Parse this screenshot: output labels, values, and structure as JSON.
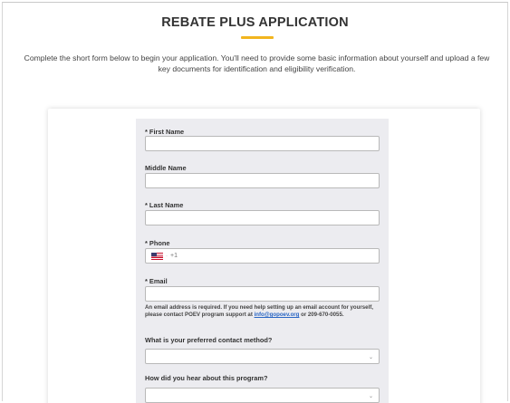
{
  "page": {
    "title": "REBATE PLUS APPLICATION",
    "intro_line1": "Complete the short form below to begin your application. You'll need to provide some basic information about yourself and upload a few",
    "intro_line2": "key documents for identification and eligibility verification."
  },
  "form": {
    "first_name": {
      "label": "* First Name",
      "value": ""
    },
    "middle_name": {
      "label": "Middle Name",
      "value": ""
    },
    "last_name": {
      "label": "* Last Name",
      "value": ""
    },
    "phone": {
      "label": "* Phone",
      "country_flag": "us-flag-icon",
      "dial_separator": "·",
      "dial_code": "+1",
      "value": ""
    },
    "email": {
      "label": "* Email",
      "value": "",
      "help_prefix": "An email address is required. If you need help setting up an email account for yourself, please contact POEV program support at ",
      "help_link": "info@gopoev.org",
      "help_suffix": " or 209-670-0055."
    },
    "contact_method": {
      "label": "What is your preferred contact method?",
      "value": ""
    },
    "heard_about": {
      "label": "How did you hear about this program?",
      "value": ""
    }
  },
  "colors": {
    "accent": "#f2b51e",
    "panel_bg": "#ececf0",
    "link": "#2a66c4"
  }
}
